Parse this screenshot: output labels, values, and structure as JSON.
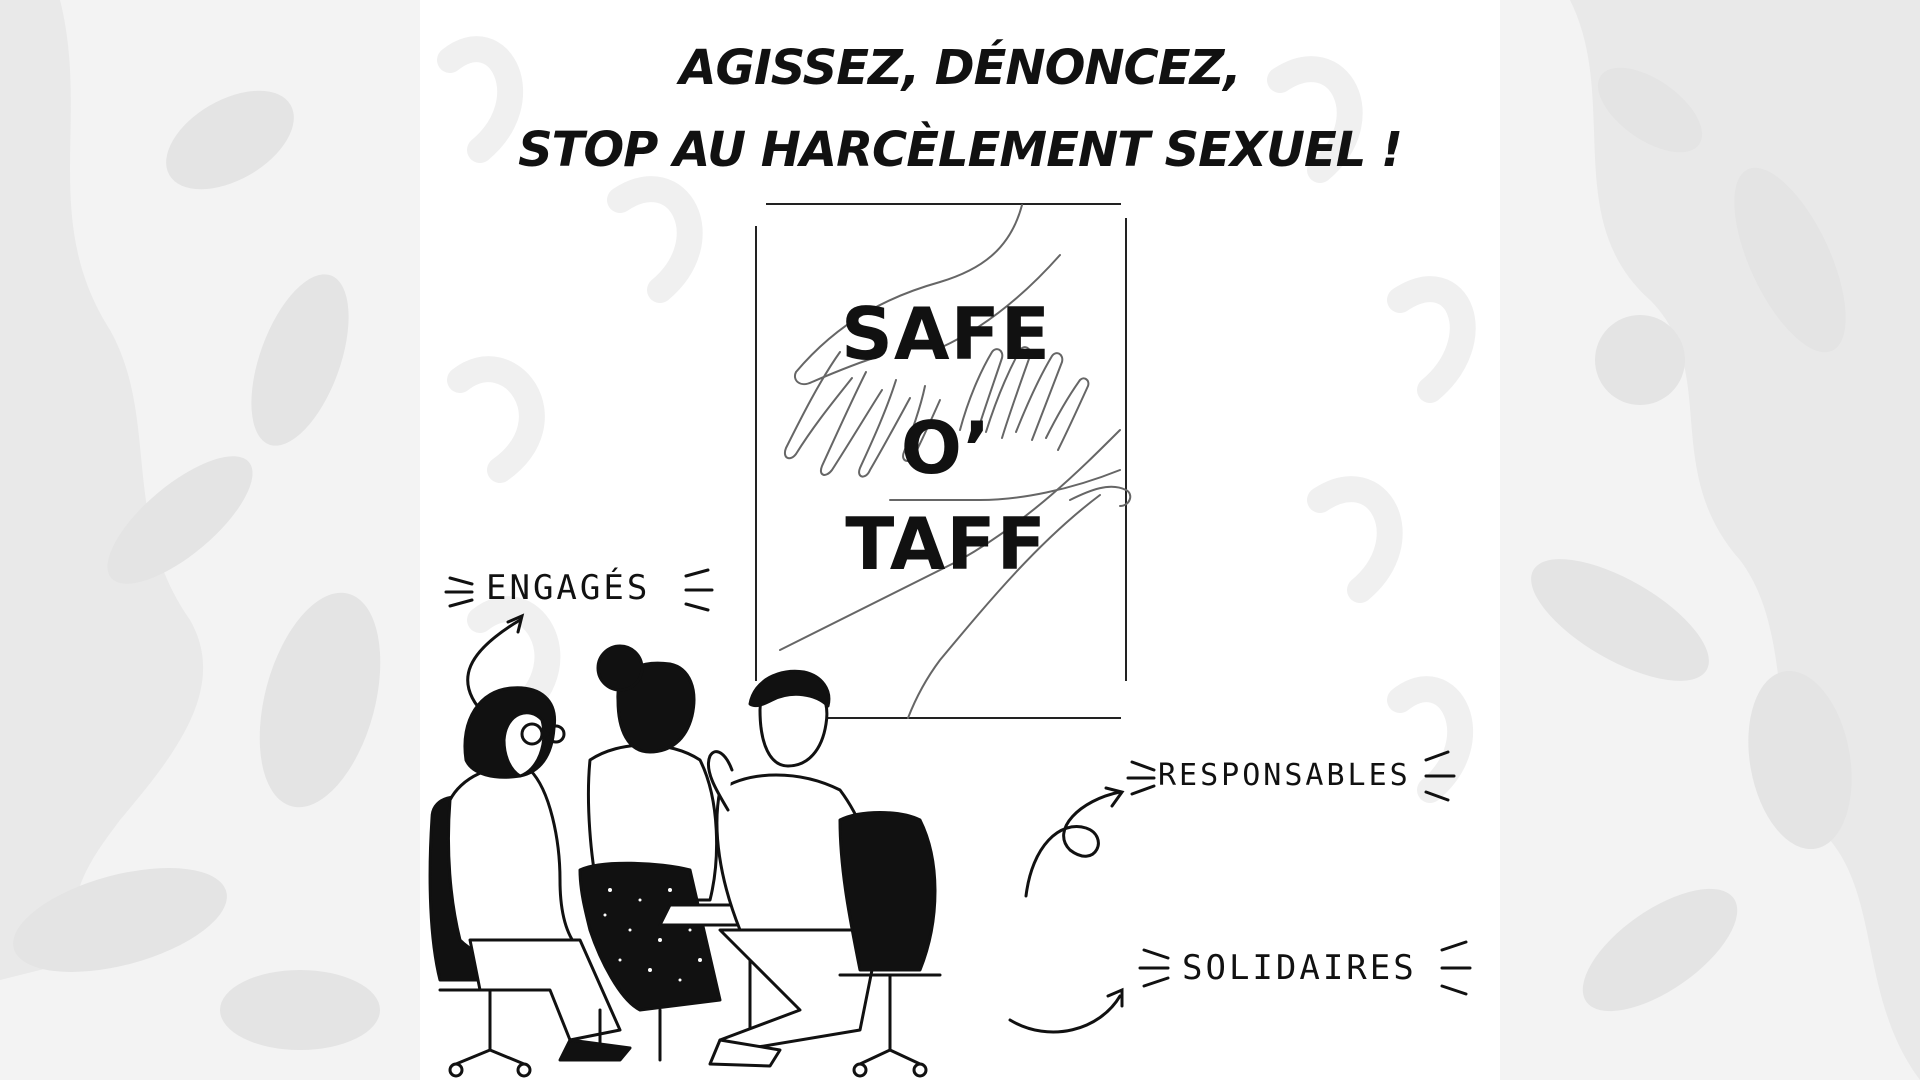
{
  "headline": {
    "line1": "AGISSEZ, DÉNONCEZ,",
    "line2": "STOP AU HARCÈLEMENT SEXUEL !"
  },
  "logo": {
    "word1": "SAFE",
    "word2": "O’",
    "word3": "TAFF"
  },
  "tags": {
    "engages": "ENGAGÉS",
    "responsables": "RESPONSABLES",
    "solidaires": "SOLIDAIRES"
  },
  "colors": {
    "ink": "#111111",
    "pattern": "#e6e6e6",
    "background": "#f3f3f3",
    "poster": "#ffffff"
  }
}
